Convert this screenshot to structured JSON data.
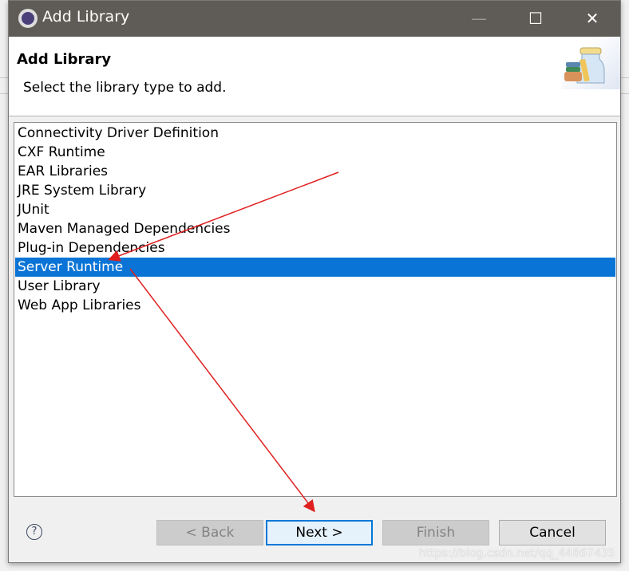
{
  "window": {
    "title": "Add Library",
    "minimize": "—",
    "maximize": "☐",
    "close": "✕"
  },
  "header": {
    "title": "Add Library",
    "description": "Select the library type to add."
  },
  "list": {
    "items": [
      "Connectivity Driver Definition",
      "CXF Runtime",
      "EAR Libraries",
      "JRE System Library",
      "JUnit",
      "Maven Managed Dependencies",
      "Plug-in Dependencies",
      "Server Runtime",
      "User Library",
      "Web App Libraries"
    ],
    "selected": "Server Runtime"
  },
  "footer": {
    "help": "?",
    "back": "< Back",
    "next": "Next >",
    "finish": "Finish",
    "cancel": "Cancel"
  },
  "watermark": "https://blog.csdn.net/qq_44867435",
  "colors": {
    "selection": "#0a74d6",
    "titlebar": "#5f5b56",
    "annotation_arrow": "#e02020"
  }
}
